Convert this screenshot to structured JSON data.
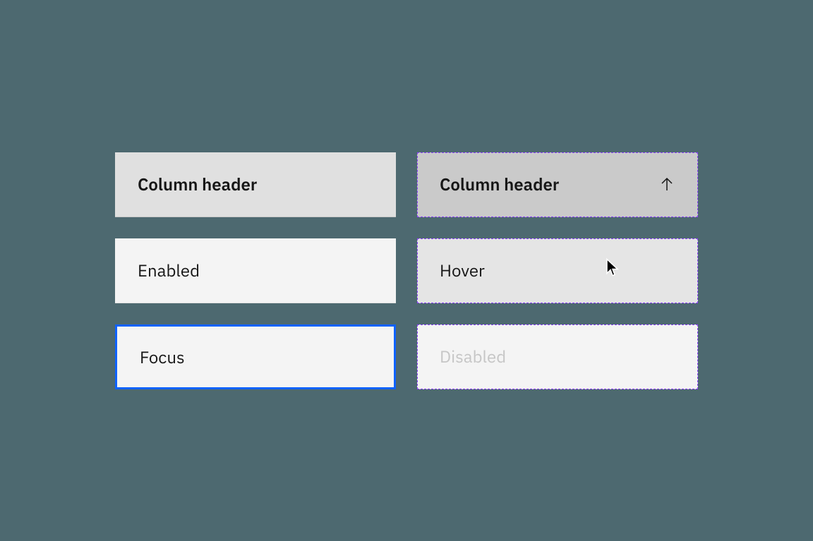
{
  "headers": {
    "left": "Column header",
    "right": "Column header",
    "sort_icon": "arrow-up"
  },
  "rows": {
    "enabled": "Enabled",
    "hover": "Hover",
    "focus": "Focus",
    "disabled": "Disabled"
  }
}
